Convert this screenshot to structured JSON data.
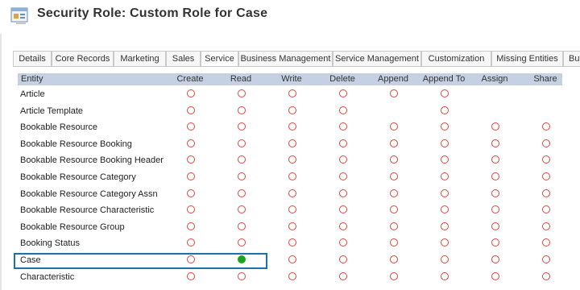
{
  "header": {
    "title": "Security Role: Custom Role for Case",
    "icon": "security-role-icon"
  },
  "tabs": [
    {
      "label": "Details",
      "active": false
    },
    {
      "label": "Core Records",
      "active": false
    },
    {
      "label": "Marketing",
      "active": false
    },
    {
      "label": "Sales",
      "active": false
    },
    {
      "label": "Service",
      "active": true
    },
    {
      "label": "Business Management",
      "active": false
    },
    {
      "label": "Service Management",
      "active": false
    },
    {
      "label": "Customization",
      "active": false
    },
    {
      "label": "Missing Entities",
      "active": false
    },
    {
      "label": "Bus",
      "active": false
    }
  ],
  "grid": {
    "columns": [
      "Entity",
      "Create",
      "Read",
      "Write",
      "Delete",
      "Append",
      "Append To",
      "Assign",
      "Share"
    ],
    "rows": [
      {
        "entity": "Article",
        "perms": [
          "none",
          "none",
          "none",
          "none",
          "none",
          "none",
          "",
          ""
        ]
      },
      {
        "entity": "Article Template",
        "perms": [
          "none",
          "none",
          "none",
          "none",
          "",
          "none",
          "",
          ""
        ]
      },
      {
        "entity": "Bookable Resource",
        "perms": [
          "none",
          "none",
          "none",
          "none",
          "none",
          "none",
          "none",
          "none"
        ]
      },
      {
        "entity": "Bookable Resource Booking",
        "perms": [
          "none",
          "none",
          "none",
          "none",
          "none",
          "none",
          "none",
          "none"
        ]
      },
      {
        "entity": "Bookable Resource Booking Header",
        "perms": [
          "none",
          "none",
          "none",
          "none",
          "none",
          "none",
          "none",
          "none"
        ]
      },
      {
        "entity": "Bookable Resource Category",
        "perms": [
          "none",
          "none",
          "none",
          "none",
          "none",
          "none",
          "none",
          "none"
        ]
      },
      {
        "entity": "Bookable Resource Category Assn",
        "perms": [
          "none",
          "none",
          "none",
          "none",
          "none",
          "none",
          "none",
          "none"
        ]
      },
      {
        "entity": "Bookable Resource Characteristic",
        "perms": [
          "none",
          "none",
          "none",
          "none",
          "none",
          "none",
          "none",
          "none"
        ]
      },
      {
        "entity": "Bookable Resource Group",
        "perms": [
          "none",
          "none",
          "none",
          "none",
          "none",
          "none",
          "none",
          "none"
        ]
      },
      {
        "entity": "Booking Status",
        "perms": [
          "none",
          "none",
          "none",
          "none",
          "none",
          "none",
          "none",
          "none"
        ]
      },
      {
        "entity": "Case",
        "perms": [
          "none",
          "full",
          "none",
          "none",
          "none",
          "none",
          "none",
          "none"
        ],
        "highlighted": true
      },
      {
        "entity": "Characteristic",
        "perms": [
          "none",
          "none",
          "none",
          "none",
          "none",
          "none",
          "none",
          "none"
        ]
      }
    ]
  },
  "colors": {
    "header_bg": "#c5d1e2",
    "none_ring": "#e0443c",
    "full_dot": "#16a51c",
    "highlight": "#1a73a8"
  }
}
